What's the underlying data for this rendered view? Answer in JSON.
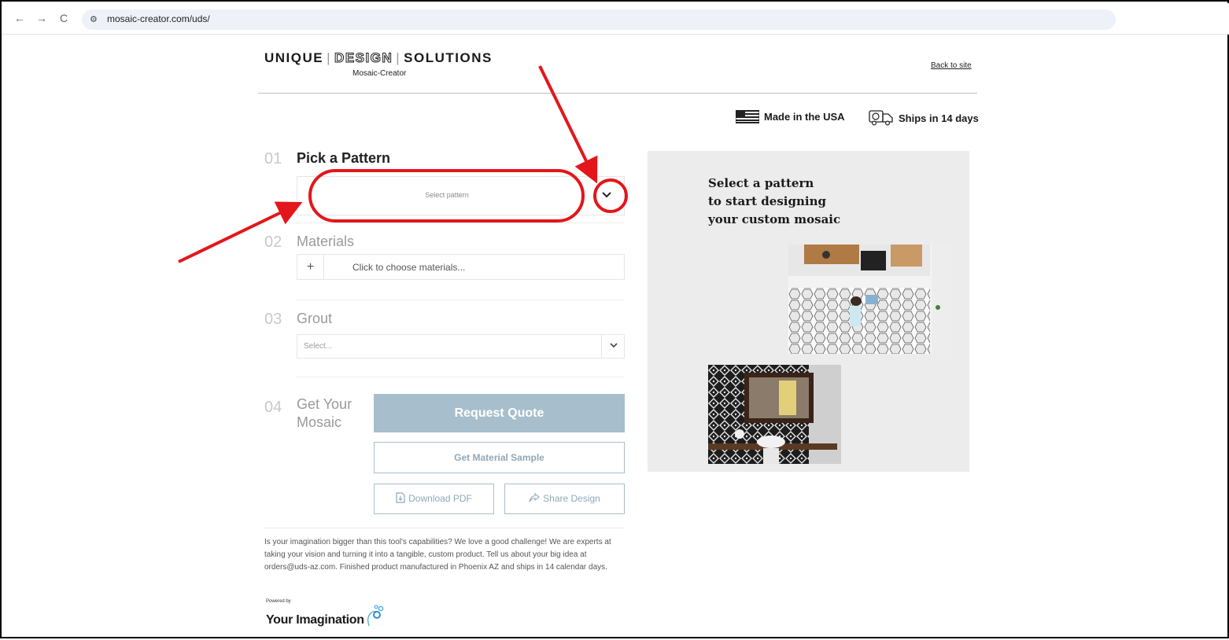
{
  "browser": {
    "back_icon": "←",
    "forward_icon": "→",
    "reload_icon": "C",
    "site_settings_icon": "⚙",
    "url": "mosaic-creator.com/uds/"
  },
  "header": {
    "brand_word1": "UNIQUE",
    "brand_word2": "DESIGN",
    "brand_word3": "SOLUTIONS",
    "brand_separator": "|",
    "subtitle": "Mosaic-Creator",
    "back_link": "Back to site"
  },
  "badges": {
    "made_in_usa": "Made in the USA",
    "ships": "Ships in 14 days"
  },
  "steps": {
    "pattern": {
      "number": "01",
      "title": "Pick a Pattern",
      "placeholder": "Select pattern",
      "chevron": "⌄"
    },
    "materials": {
      "number": "02",
      "title": "Materials",
      "plus": "+",
      "placeholder": "Click to choose materials..."
    },
    "grout": {
      "number": "03",
      "title": "Grout",
      "placeholder": "Select...",
      "chevron": "⌄"
    },
    "get": {
      "number": "04",
      "title_line1": "Get Your",
      "title_line2": "Mosaic"
    }
  },
  "buttons": {
    "request_quote": "Request Quote",
    "material_sample": "Get Material Sample",
    "download_pdf": "Download PDF",
    "share_design": "Share Design"
  },
  "footer": {
    "text": "Is your imagination bigger than this tool's capabilities? We love a good challenge! We are experts at taking your vision and turning it into a tangible, custom product. Tell us about your big idea at orders@uds-az.com. Finished product manufactured in Phoenix AZ and ships in 14 calendar days.",
    "powered_by": "Powered by",
    "powered_name": "Your Imagination"
  },
  "panel": {
    "heading_line1": "Select a pattern",
    "heading_line2": "to start designing",
    "heading_line3": "your custom mosaic"
  },
  "colors": {
    "accent": "#a7bfcc",
    "annotation": "#e3161b"
  }
}
